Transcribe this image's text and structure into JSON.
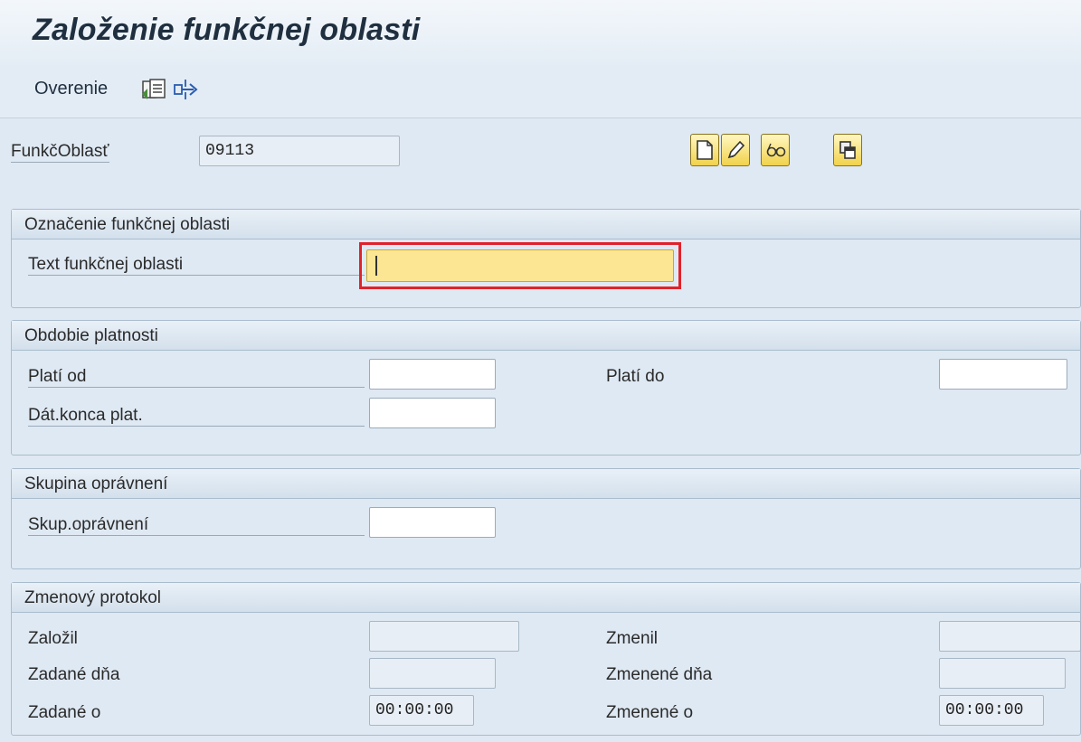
{
  "title": "Založenie funkčnej oblasti",
  "toolbar": {
    "check_label": "Overenie",
    "icons": [
      "object-list-icon",
      "navigate-icon"
    ]
  },
  "key": {
    "label": "FunkčOblasť",
    "value": "09113",
    "buttons": [
      "create-icon",
      "change-icon",
      "display-icon",
      "copy-icon"
    ]
  },
  "groups": {
    "designation": {
      "header": "Označenie funkčnej oblasti",
      "text_label": "Text funkčnej oblasti",
      "text_value": ""
    },
    "validity": {
      "header": "Obdobie platnosti",
      "valid_from_label": "Platí od",
      "valid_from_value": "",
      "valid_to_label": "Platí do",
      "valid_to_value": "",
      "end_date_label": "Dát.konca plat.",
      "end_date_value": ""
    },
    "authorization": {
      "header": "Skupina oprávnení",
      "auth_label": "Skup.oprávnení",
      "auth_value": ""
    },
    "changelog": {
      "header": "Zmenový protokol",
      "created_by_label": "Založil",
      "created_by_value": "",
      "changed_by_label": "Zmenil",
      "changed_by_value": "",
      "created_on_label": "Zadané dňa",
      "created_on_value": "",
      "changed_on_label": "Zmenené dňa",
      "changed_on_value": "",
      "created_at_label": "Zadané o",
      "created_at_value": "00:00:00",
      "changed_at_label": "Zmenené o",
      "changed_at_value": "00:00:00"
    }
  },
  "colors": {
    "focus_border": "#e1222b",
    "required_field": "#fce694",
    "background": "#dfe9f3"
  }
}
